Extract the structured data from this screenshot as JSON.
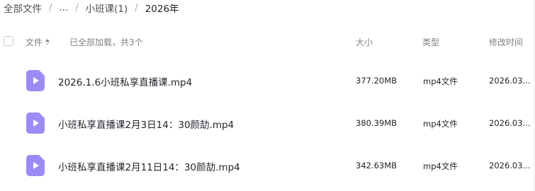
{
  "breadcrumb": {
    "items": [
      "全部文件",
      "...",
      "小班课(1)",
      "2026年"
    ],
    "separator": "/"
  },
  "header": {
    "name_label": "文件",
    "count_text": "已全部加载，共3个",
    "size_label": "大小",
    "type_label": "类型",
    "mtime_label": "修改时间"
  },
  "files": [
    {
      "name": "2026.1.6小班私享直播课.mp4",
      "size": "377.20MB",
      "type": "mp4文件",
      "mtime": "2026.03..."
    },
    {
      "name": "小班私享直播课2月3日14：30颜劼.mp4",
      "size": "380.39MB",
      "type": "mp4文件",
      "mtime": "2026.03..."
    },
    {
      "name": "小班私享直播课2月11日14：30颜劼.mp4",
      "size": "342.63MB",
      "type": "mp4文件",
      "mtime": "2026.03..."
    }
  ],
  "colors": {
    "video_icon": "#9b8cf5",
    "text_primary": "#1f2329",
    "text_secondary": "#7d8087"
  },
  "icons": {
    "file": "video-file-icon",
    "sort": "sort-icon"
  }
}
